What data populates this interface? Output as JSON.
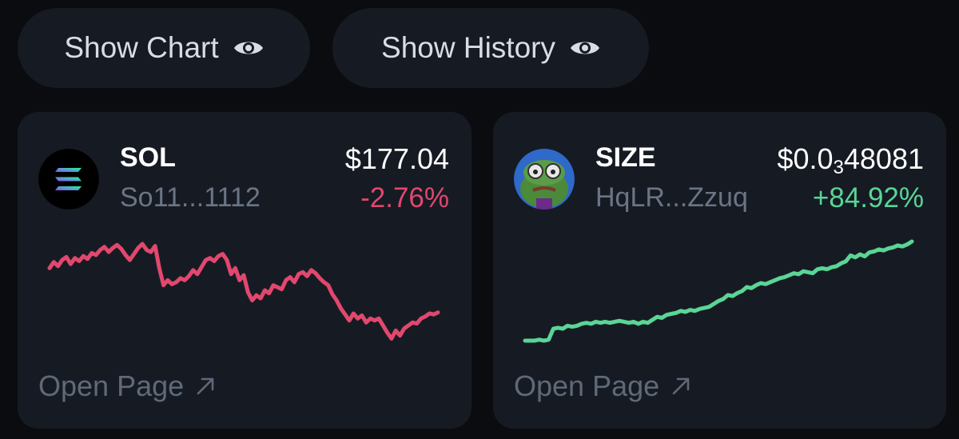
{
  "toolbar": {
    "show_chart_label": "Show Chart",
    "show_history_label": "Show History",
    "eye_icon": "eye-icon"
  },
  "tokens": [
    {
      "symbol": "SOL",
      "address": "So11...1112",
      "price": "$177.04",
      "change": "-2.76%",
      "change_direction": "down",
      "color": "#e2476e",
      "logo_icon": "solana-logo-icon",
      "open_label": "Open Page",
      "sparkline": [
        0.72,
        0.78,
        0.74,
        0.8,
        0.83,
        0.76,
        0.82,
        0.79,
        0.84,
        0.81,
        0.87,
        0.85,
        0.9,
        0.93,
        0.88,
        0.92,
        0.95,
        0.91,
        0.85,
        0.8,
        0.86,
        0.92,
        0.96,
        0.9,
        0.88,
        0.94,
        0.72,
        0.55,
        0.6,
        0.56,
        0.58,
        0.62,
        0.6,
        0.64,
        0.7,
        0.66,
        0.73,
        0.8,
        0.82,
        0.79,
        0.84,
        0.86,
        0.8,
        0.66,
        0.72,
        0.6,
        0.65,
        0.48,
        0.4,
        0.45,
        0.42,
        0.5,
        0.47,
        0.55,
        0.53,
        0.51,
        0.6,
        0.63,
        0.58,
        0.66,
        0.68,
        0.64,
        0.7,
        0.67,
        0.62,
        0.58,
        0.55,
        0.46,
        0.4,
        0.32,
        0.26,
        0.2,
        0.27,
        0.22,
        0.25,
        0.18,
        0.22,
        0.2,
        0.22,
        0.15,
        0.08,
        0.02,
        0.1,
        0.05,
        0.12,
        0.15,
        0.18,
        0.17,
        0.22,
        0.24,
        0.27,
        0.26,
        0.28
      ]
    },
    {
      "symbol": "SIZE",
      "address": "HqLR...Zzuq",
      "price_prefix": "$0.0",
      "price_subscript": "3",
      "price_suffix": "48081",
      "change": "+84.92%",
      "change_direction": "up",
      "color": "#5ad596",
      "logo_icon": "pepe-avatar-icon",
      "open_label": "Open Page",
      "sparkline": [
        0.0,
        0.0,
        0.0,
        0.01,
        0.0,
        0.01,
        0.12,
        0.13,
        0.12,
        0.15,
        0.14,
        0.15,
        0.17,
        0.18,
        0.17,
        0.19,
        0.18,
        0.19,
        0.18,
        0.19,
        0.2,
        0.19,
        0.18,
        0.19,
        0.17,
        0.19,
        0.18,
        0.21,
        0.24,
        0.23,
        0.26,
        0.27,
        0.28,
        0.3,
        0.29,
        0.31,
        0.3,
        0.32,
        0.33,
        0.34,
        0.37,
        0.4,
        0.42,
        0.46,
        0.45,
        0.48,
        0.5,
        0.54,
        0.53,
        0.56,
        0.58,
        0.57,
        0.59,
        0.61,
        0.63,
        0.64,
        0.66,
        0.68,
        0.67,
        0.7,
        0.69,
        0.68,
        0.72,
        0.73,
        0.72,
        0.74,
        0.75,
        0.78,
        0.8,
        0.86,
        0.84,
        0.87,
        0.85,
        0.89,
        0.9,
        0.92,
        0.91,
        0.93,
        0.94,
        0.96,
        0.95,
        0.97,
        1.0
      ]
    }
  ]
}
